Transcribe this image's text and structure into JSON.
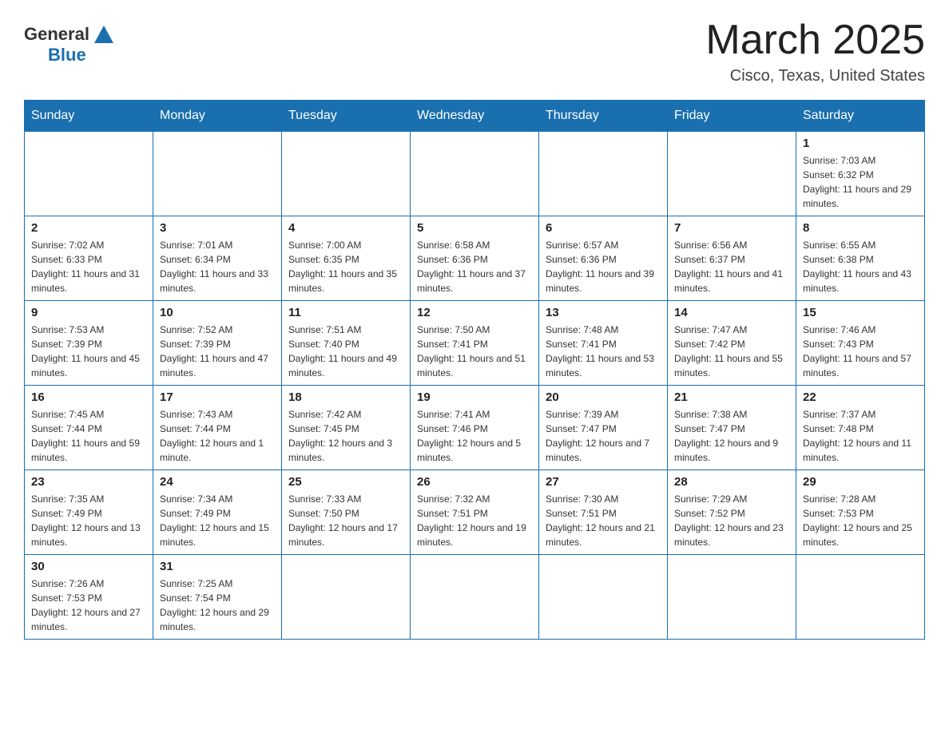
{
  "header": {
    "logo_general": "General",
    "logo_blue": "Blue",
    "title": "March 2025",
    "subtitle": "Cisco, Texas, United States"
  },
  "weekdays": [
    "Sunday",
    "Monday",
    "Tuesday",
    "Wednesday",
    "Thursday",
    "Friday",
    "Saturday"
  ],
  "weeks": [
    [
      {
        "day": "",
        "info": ""
      },
      {
        "day": "",
        "info": ""
      },
      {
        "day": "",
        "info": ""
      },
      {
        "day": "",
        "info": ""
      },
      {
        "day": "",
        "info": ""
      },
      {
        "day": "",
        "info": ""
      },
      {
        "day": "1",
        "info": "Sunrise: 7:03 AM\nSunset: 6:32 PM\nDaylight: 11 hours and 29 minutes."
      }
    ],
    [
      {
        "day": "2",
        "info": "Sunrise: 7:02 AM\nSunset: 6:33 PM\nDaylight: 11 hours and 31 minutes."
      },
      {
        "day": "3",
        "info": "Sunrise: 7:01 AM\nSunset: 6:34 PM\nDaylight: 11 hours and 33 minutes."
      },
      {
        "day": "4",
        "info": "Sunrise: 7:00 AM\nSunset: 6:35 PM\nDaylight: 11 hours and 35 minutes."
      },
      {
        "day": "5",
        "info": "Sunrise: 6:58 AM\nSunset: 6:36 PM\nDaylight: 11 hours and 37 minutes."
      },
      {
        "day": "6",
        "info": "Sunrise: 6:57 AM\nSunset: 6:36 PM\nDaylight: 11 hours and 39 minutes."
      },
      {
        "day": "7",
        "info": "Sunrise: 6:56 AM\nSunset: 6:37 PM\nDaylight: 11 hours and 41 minutes."
      },
      {
        "day": "8",
        "info": "Sunrise: 6:55 AM\nSunset: 6:38 PM\nDaylight: 11 hours and 43 minutes."
      }
    ],
    [
      {
        "day": "9",
        "info": "Sunrise: 7:53 AM\nSunset: 7:39 PM\nDaylight: 11 hours and 45 minutes."
      },
      {
        "day": "10",
        "info": "Sunrise: 7:52 AM\nSunset: 7:39 PM\nDaylight: 11 hours and 47 minutes."
      },
      {
        "day": "11",
        "info": "Sunrise: 7:51 AM\nSunset: 7:40 PM\nDaylight: 11 hours and 49 minutes."
      },
      {
        "day": "12",
        "info": "Sunrise: 7:50 AM\nSunset: 7:41 PM\nDaylight: 11 hours and 51 minutes."
      },
      {
        "day": "13",
        "info": "Sunrise: 7:48 AM\nSunset: 7:41 PM\nDaylight: 11 hours and 53 minutes."
      },
      {
        "day": "14",
        "info": "Sunrise: 7:47 AM\nSunset: 7:42 PM\nDaylight: 11 hours and 55 minutes."
      },
      {
        "day": "15",
        "info": "Sunrise: 7:46 AM\nSunset: 7:43 PM\nDaylight: 11 hours and 57 minutes."
      }
    ],
    [
      {
        "day": "16",
        "info": "Sunrise: 7:45 AM\nSunset: 7:44 PM\nDaylight: 11 hours and 59 minutes."
      },
      {
        "day": "17",
        "info": "Sunrise: 7:43 AM\nSunset: 7:44 PM\nDaylight: 12 hours and 1 minute."
      },
      {
        "day": "18",
        "info": "Sunrise: 7:42 AM\nSunset: 7:45 PM\nDaylight: 12 hours and 3 minutes."
      },
      {
        "day": "19",
        "info": "Sunrise: 7:41 AM\nSunset: 7:46 PM\nDaylight: 12 hours and 5 minutes."
      },
      {
        "day": "20",
        "info": "Sunrise: 7:39 AM\nSunset: 7:47 PM\nDaylight: 12 hours and 7 minutes."
      },
      {
        "day": "21",
        "info": "Sunrise: 7:38 AM\nSunset: 7:47 PM\nDaylight: 12 hours and 9 minutes."
      },
      {
        "day": "22",
        "info": "Sunrise: 7:37 AM\nSunset: 7:48 PM\nDaylight: 12 hours and 11 minutes."
      }
    ],
    [
      {
        "day": "23",
        "info": "Sunrise: 7:35 AM\nSunset: 7:49 PM\nDaylight: 12 hours and 13 minutes."
      },
      {
        "day": "24",
        "info": "Sunrise: 7:34 AM\nSunset: 7:49 PM\nDaylight: 12 hours and 15 minutes."
      },
      {
        "day": "25",
        "info": "Sunrise: 7:33 AM\nSunset: 7:50 PM\nDaylight: 12 hours and 17 minutes."
      },
      {
        "day": "26",
        "info": "Sunrise: 7:32 AM\nSunset: 7:51 PM\nDaylight: 12 hours and 19 minutes."
      },
      {
        "day": "27",
        "info": "Sunrise: 7:30 AM\nSunset: 7:51 PM\nDaylight: 12 hours and 21 minutes."
      },
      {
        "day": "28",
        "info": "Sunrise: 7:29 AM\nSunset: 7:52 PM\nDaylight: 12 hours and 23 minutes."
      },
      {
        "day": "29",
        "info": "Sunrise: 7:28 AM\nSunset: 7:53 PM\nDaylight: 12 hours and 25 minutes."
      }
    ],
    [
      {
        "day": "30",
        "info": "Sunrise: 7:26 AM\nSunset: 7:53 PM\nDaylight: 12 hours and 27 minutes."
      },
      {
        "day": "31",
        "info": "Sunrise: 7:25 AM\nSunset: 7:54 PM\nDaylight: 12 hours and 29 minutes."
      },
      {
        "day": "",
        "info": ""
      },
      {
        "day": "",
        "info": ""
      },
      {
        "day": "",
        "info": ""
      },
      {
        "day": "",
        "info": ""
      },
      {
        "day": "",
        "info": ""
      }
    ]
  ]
}
